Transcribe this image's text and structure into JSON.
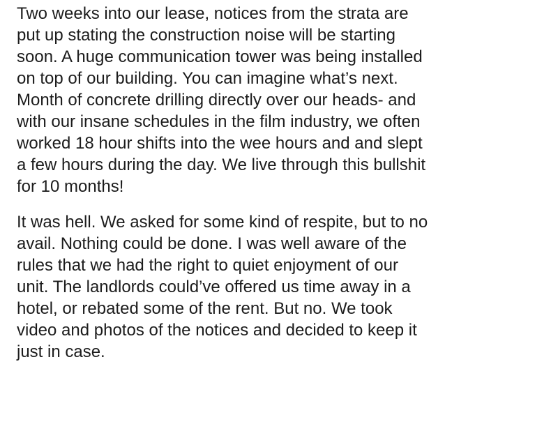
{
  "paragraphs": [
    {
      "lines": [
        "Two weeks into our lease, notices from the strata are",
        "put up stating the construction noise will be starting",
        "soon. A huge communication tower was being installed",
        "on top of our building. You can imagine what’s next.",
        "Month of concrete drilling directly over our heads- and",
        "with our insane schedules in the film industry, we often",
        "worked 18 hour shifts into the wee hours and and slept",
        "a few hours during the day. We live through this bullshit",
        "for 10 months!"
      ]
    },
    {
      "lines": [
        "It was hell. We asked for some kind of respite, but to no",
        "avail. Nothing could be done. I was well aware of the",
        "rules that we had the right to quiet enjoyment of our",
        "unit. The landlords could’ve offered us time away in a",
        "hotel, or rebated some of the rent. But no. We took",
        "video and photos of the notices and decided to keep it",
        "just in case."
      ]
    }
  ]
}
